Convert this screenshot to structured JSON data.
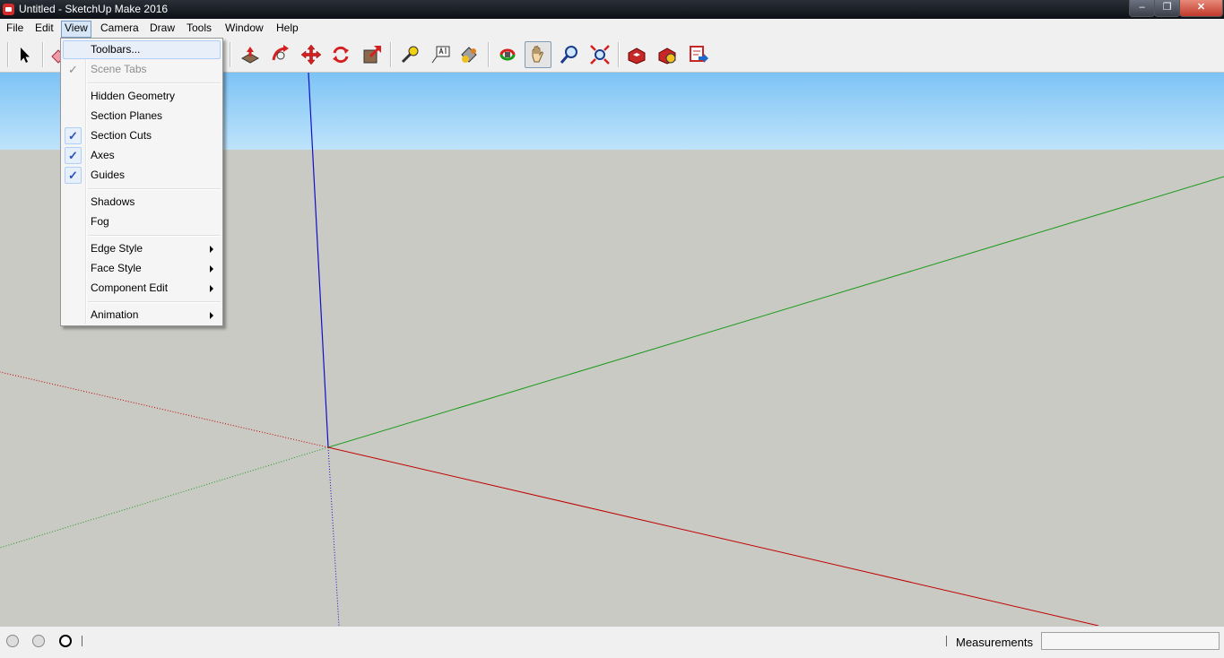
{
  "window": {
    "title": "Untitled - SketchUp Make 2016",
    "min": "‒",
    "max": "❐",
    "close": "✕"
  },
  "menubar": [
    "File",
    "Edit",
    "View",
    "Camera",
    "Draw",
    "Tools",
    "Window",
    "Help"
  ],
  "view_menu": {
    "items": [
      {
        "label": "Toolbars...",
        "checked": false,
        "disabled": false,
        "submenu": false
      },
      {
        "label": "Scene Tabs",
        "checked": true,
        "disabled": true,
        "submenu": false
      },
      {
        "label": "Hidden Geometry",
        "checked": false,
        "disabled": false,
        "submenu": false
      },
      {
        "label": "Section Planes",
        "checked": false,
        "disabled": false,
        "submenu": false
      },
      {
        "label": "Section Cuts",
        "checked": true,
        "disabled": false,
        "submenu": false
      },
      {
        "label": "Axes",
        "checked": true,
        "disabled": false,
        "submenu": false
      },
      {
        "label": "Guides",
        "checked": true,
        "disabled": false,
        "submenu": false
      },
      {
        "label": "Shadows",
        "checked": false,
        "disabled": false,
        "submenu": false
      },
      {
        "label": "Fog",
        "checked": false,
        "disabled": false,
        "submenu": false
      },
      {
        "label": "Edge Style",
        "checked": false,
        "disabled": false,
        "submenu": true
      },
      {
        "label": "Face Style",
        "checked": false,
        "disabled": false,
        "submenu": true
      },
      {
        "label": "Component Edit",
        "checked": false,
        "disabled": false,
        "submenu": true
      },
      {
        "label": "Animation",
        "checked": false,
        "disabled": false,
        "submenu": true
      }
    ],
    "check_mark": "✓"
  },
  "statusbar": {
    "measurements_label": "Measurements",
    "measurements_value": ""
  },
  "colors": {
    "red_axis": "#c00000",
    "green_axis": "#1a9a1a",
    "blue_axis": "#1010c8",
    "sky": "#9fd3f9",
    "ground": "#cacac4"
  }
}
